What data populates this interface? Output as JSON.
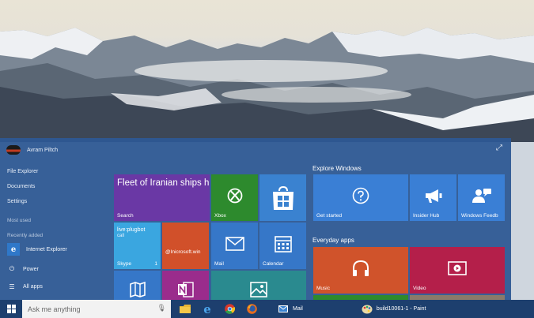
{
  "user": {
    "name": "Avram Piltch"
  },
  "left_menu": {
    "file_explorer": "File Explorer",
    "documents": "Documents",
    "settings": "Settings",
    "most_used": "Most used",
    "recently_added": "Recently added",
    "recent_app": "Internet Explorer",
    "power": "Power",
    "all_apps": "All apps"
  },
  "tiles": {
    "news_headline": "Fleet of Iranian ships heading to Yemen turn",
    "news_label": "Search",
    "xbox": "Xbox",
    "skype_title": "live:plugbot",
    "skype_sub": "call",
    "skype_label": "Skype",
    "skype_badge": "1",
    "twitter_handle": "@Inicrosoft.win",
    "mail": "Mail",
    "calendar": "Calendar"
  },
  "groups": {
    "explore_title": "Explore Windows",
    "explore_tiles": [
      "Get started",
      "Insider Hub",
      "Windows Feedb"
    ],
    "everyday_title": "Everyday apps",
    "music": "Music",
    "video": "Video"
  },
  "taskbar": {
    "search_placeholder": "Ask me anything",
    "mail_label": "Mail",
    "paint_label": "build10061-1 - Paint"
  },
  "colors": {
    "menu_bg": "#2e5894",
    "taskbar_bg": "#1d3f6e",
    "news_tile": "#6a38a5",
    "xbox_tile": "#2d8a2d",
    "store_tile": "#3a82d0",
    "skype_tile": "#3aa6e0",
    "twitter_tile": "#d1502a",
    "mail_tile": "#3677c8",
    "calendar_tile": "#3677c8",
    "explore_tile": "#3a7fd5",
    "music_tile": "#d0532b",
    "video_tile": "#b41f4a"
  }
}
